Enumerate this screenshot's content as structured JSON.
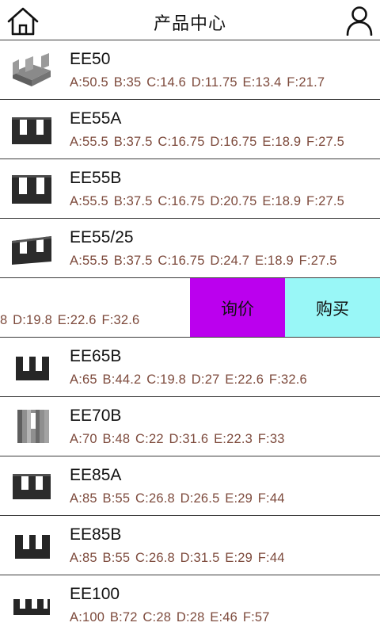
{
  "header": {
    "title": "产品中心"
  },
  "swipe_actions": {
    "inquire_label": "询价",
    "buy_label": "购买"
  },
  "colors": {
    "inquire_bg": "#bb00ee",
    "buy_bg": "#99f7f7",
    "spec_text": "#7d4a3c"
  },
  "products": [
    {
      "name": "EE50",
      "specs": "A:50.5 B:35 C:14.6 D:11.75 E:13.4 F:21.7",
      "icon": "ferrite-core-gray-icon"
    },
    {
      "name": "EE55A",
      "specs": "A:55.5 B:37.5 C:16.75 D:16.75 E:18.9 F:27.5",
      "icon": "ferrite-core-icon"
    },
    {
      "name": "EE55B",
      "specs": "A:55.5 B:37.5 C:16.75 D:20.75 E:18.9 F:27.5",
      "icon": "ferrite-core-icon"
    },
    {
      "name": "EE55/25",
      "specs": "A:55.5 B:37.5 C:16.75 D:24.7 E:18.9 F:27.5",
      "icon": "ferrite-core-icon"
    },
    {
      "name": "",
      "specs": "8 D:19.8 E:22.6 F:32.6",
      "icon": ""
    },
    {
      "name": "EE65B",
      "specs": "A:65 B:44.2 C:19.8 D:27 E:22.6 F:32.6",
      "icon": "ferrite-core-icon"
    },
    {
      "name": "EE70B",
      "specs": "A:70 B:48 C:22 D:31.6 E:22.3 F:33",
      "icon": "ferrite-core-stack-icon"
    },
    {
      "name": "EE85A",
      "specs": "A:85 B:55 C:26.8 D:26.5 E:29 F:44",
      "icon": "ferrite-core-icon"
    },
    {
      "name": "EE85B",
      "specs": "A:85 B:55 C:26.8 D:31.5 E:29 F:44",
      "icon": "ferrite-core-icon"
    },
    {
      "name": "EE100",
      "specs": "A:100 B:72 C:28 D:28 E:46 F:57",
      "icon": "ferrite-core-flat-icon"
    }
  ]
}
